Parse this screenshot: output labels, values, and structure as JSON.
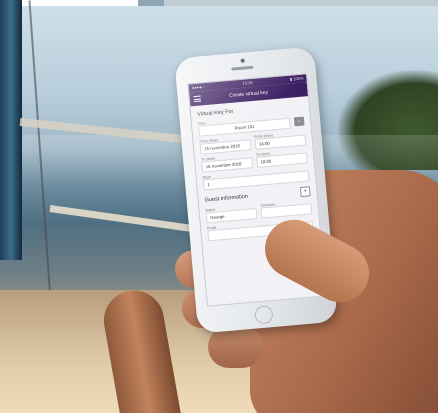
{
  "app": {
    "status_carrier": "●●●●○",
    "status_time": "10:38",
    "status_battery": "▮ 100%",
    "title": "Create virtual key"
  },
  "form": {
    "section_title": "Virtual Key For",
    "door_label": "Door",
    "door_value": "Room 101",
    "door_button": "⌄",
    "from_date_label": "From (date)",
    "from_date_value": "15 novembre 2016",
    "from_time_label": "From (time)",
    "from_time_value": "14:00",
    "to_date_label": "To (date)",
    "to_date_value": "16 novembre 2016",
    "to_time_label": "To (time)",
    "to_time_value": "10:00",
    "days_label": "Days",
    "days_value": "1",
    "guest_title": "Guest information",
    "add_guest_button": "+",
    "name_label": "Name",
    "name_value": "George",
    "surname_label": "Surname",
    "surname_value": "",
    "email_label": "Email",
    "email_value": ""
  }
}
